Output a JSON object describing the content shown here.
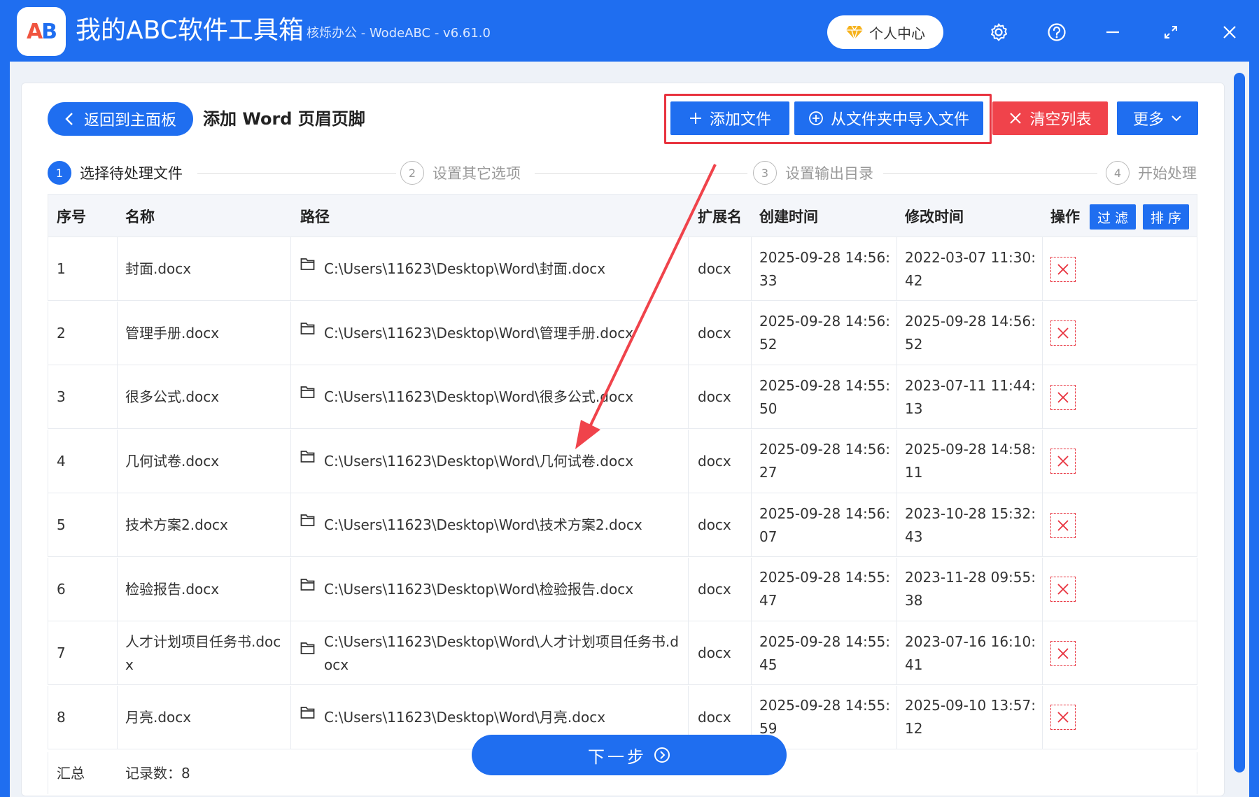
{
  "app": {
    "logo_text_a": "A",
    "logo_text_b": "B",
    "title": "我的ABC软件工具箱",
    "subtitle": "核烁办公 - WodeABC - v6.61.0",
    "user_center": "个人中心"
  },
  "toolbar": {
    "back_label": "返回到主面板",
    "page_title": "添加 Word 页眉页脚",
    "add_file": "添加文件",
    "import_folder": "从文件夹中导入文件",
    "clear_list": "清空列表",
    "more": "更多"
  },
  "steps": [
    {
      "num": "1",
      "label": "选择待处理文件"
    },
    {
      "num": "2",
      "label": "设置其它选项"
    },
    {
      "num": "3",
      "label": "设置输出目录"
    },
    {
      "num": "4",
      "label": "开始处理"
    }
  ],
  "table": {
    "headers": {
      "index": "序号",
      "name": "名称",
      "path": "路径",
      "ext": "扩展名",
      "created": "创建时间",
      "modified": "修改时间",
      "action": "操作",
      "filter": "过 滤",
      "sort": "排 序"
    },
    "rows": [
      {
        "index": "1",
        "name": "封面.docx",
        "path": "C:\\Users\\11623\\Desktop\\Word\\封面.docx",
        "ext": "docx",
        "created": "2025-09-28 14:56:33",
        "modified": "2022-03-07 11:30:42"
      },
      {
        "index": "2",
        "name": "管理手册.docx",
        "path": "C:\\Users\\11623\\Desktop\\Word\\管理手册.docx",
        "ext": "docx",
        "created": "2025-09-28 14:56:52",
        "modified": "2025-09-28 14:56:52"
      },
      {
        "index": "3",
        "name": "很多公式.docx",
        "path": "C:\\Users\\11623\\Desktop\\Word\\很多公式.docx",
        "ext": "docx",
        "created": "2025-09-28 14:55:50",
        "modified": "2023-07-11 11:44:13"
      },
      {
        "index": "4",
        "name": "几何试卷.docx",
        "path": "C:\\Users\\11623\\Desktop\\Word\\几何试卷.docx",
        "ext": "docx",
        "created": "2025-09-28 14:56:27",
        "modified": "2025-09-28 14:58:11"
      },
      {
        "index": "5",
        "name": "技术方案2.docx",
        "path": "C:\\Users\\11623\\Desktop\\Word\\技术方案2.docx",
        "ext": "docx",
        "created": "2025-09-28 14:56:07",
        "modified": "2023-10-28 15:32:43"
      },
      {
        "index": "6",
        "name": "检验报告.docx",
        "path": "C:\\Users\\11623\\Desktop\\Word\\检验报告.docx",
        "ext": "docx",
        "created": "2025-09-28 14:55:47",
        "modified": "2023-11-28 09:55:38"
      },
      {
        "index": "7",
        "name": "人才计划项目任务书.docx",
        "path": "C:\\Users\\11623\\Desktop\\Word\\人才计划项目任务书.docx",
        "ext": "docx",
        "created": "2025-09-28 14:55:45",
        "modified": "2023-07-16 16:10:41"
      },
      {
        "index": "8",
        "name": "月亮.docx",
        "path": "C:\\Users\\11623\\Desktop\\Word\\月亮.docx",
        "ext": "docx",
        "created": "2025-09-28 14:55:59",
        "modified": "2025-09-10 13:57:12"
      }
    ],
    "summary_label": "汇总",
    "summary_count": "记录数：8"
  },
  "next_button": "下一步",
  "colors": {
    "primary": "#1f6ef0",
    "danger": "#f0434b",
    "highlight": "#e8333f"
  },
  "icons": {
    "gear": "gear-icon",
    "help": "help-icon",
    "minimize": "minimize-icon",
    "maximize": "maximize-icon",
    "close": "close-icon",
    "folder": "folder-icon",
    "delete": "delete-icon"
  }
}
